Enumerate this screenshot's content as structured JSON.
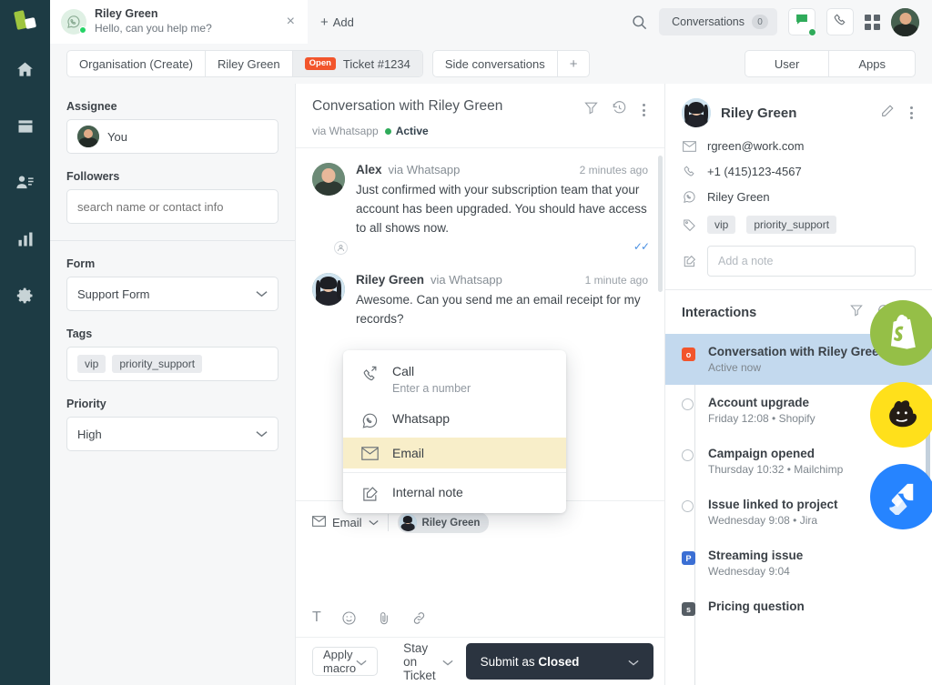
{
  "rail": {
    "logo_name": "app-logo",
    "items": [
      {
        "name": "home-icon",
        "label": "Home"
      },
      {
        "name": "inbox-icon",
        "label": "Inbox"
      },
      {
        "name": "contacts-icon",
        "label": "Contacts"
      },
      {
        "name": "reports-icon",
        "label": "Reports"
      },
      {
        "name": "settings-gear-icon",
        "label": "Settings"
      }
    ]
  },
  "topbar": {
    "conversation_pill": {
      "name": "Riley Green",
      "preview": "Hello, can you help me?",
      "channel_icon": "whatsapp-icon",
      "close_label": "×"
    },
    "add_label": "Add",
    "search_icon": "search-icon",
    "conversations_label": "Conversations",
    "conversations_count": "0",
    "chat_icon": "chat-bubble-icon",
    "phone_icon": "phone-icon",
    "apps_grid_icon": "grid-icon",
    "avatar_name": "user-avatar"
  },
  "tabs": {
    "left": [
      {
        "label": "Organisation (Create)",
        "badge": "",
        "active": false
      },
      {
        "label": "Riley Green",
        "badge": "",
        "active": false
      },
      {
        "label": "Ticket #1234",
        "badge": "Open",
        "active": true
      }
    ],
    "side_conversations_label": "Side conversations",
    "side_plus": "+",
    "right": [
      {
        "label": "User"
      },
      {
        "label": "Apps"
      }
    ]
  },
  "properties": {
    "assignee_label": "Assignee",
    "assignee_value": "You",
    "followers_label": "Followers",
    "followers_placeholder": "search name or contact info",
    "form_label": "Form",
    "form_value": "Support Form",
    "tags_label": "Tags",
    "tags": [
      "vip",
      "priority_support"
    ],
    "priority_label": "Priority",
    "priority_value": "High"
  },
  "conversation": {
    "title": "Conversation with Riley Green",
    "via": "via Whatsapp",
    "status": "Active",
    "filter_icon": "filter-icon",
    "history_icon": "history-icon",
    "more_icon": "more-vertical-icon",
    "messages": [
      {
        "author": "Alex",
        "via": "via Whatsapp",
        "time": "2 minutes ago",
        "text": "Just confirmed with your subscription team that your account has been upgraded. You should have access to all shows now.",
        "read_receipt": "✓✓",
        "is_agent": true
      },
      {
        "author": "Riley Green",
        "via": "via Whatsapp",
        "time": "1 minute ago",
        "text": "Awesome. Can you send me an email receipt for my records?",
        "read_receipt": "",
        "is_agent": false
      }
    ]
  },
  "channel_menu": {
    "items": [
      {
        "label": "Call",
        "sub": "Enter a number",
        "icon": "phone-forward-icon",
        "highlighted": false
      },
      {
        "label": "Whatsapp",
        "sub": "",
        "icon": "whatsapp-icon",
        "highlighted": false
      },
      {
        "label": "Email",
        "sub": "",
        "icon": "envelope-icon",
        "highlighted": true
      },
      {
        "label": "Internal note",
        "sub": "",
        "icon": "note-edit-icon",
        "highlighted": false
      }
    ]
  },
  "composer": {
    "channel_label": "Email",
    "channel_icon": "envelope-icon",
    "recipient": "Riley Green",
    "tools": [
      {
        "name": "text-format-icon",
        "glyph": "T"
      },
      {
        "name": "emoji-icon",
        "glyph": ""
      },
      {
        "name": "attachment-icon",
        "glyph": ""
      },
      {
        "name": "link-icon",
        "glyph": ""
      }
    ]
  },
  "footer": {
    "macro_label": "Apply macro",
    "stay_label": "Stay on Ticket",
    "submit_prefix": "Submit as ",
    "submit_state": "Closed"
  },
  "contact": {
    "name": "Riley Green",
    "edit_icon": "pencil-icon",
    "more_icon": "more-vertical-icon",
    "email": "rgreen@work.com",
    "phone": "+1 (415)123-4567",
    "whatsapp": "Riley Green",
    "tags": [
      "vip",
      "priority_support"
    ],
    "note_placeholder": "Add a note"
  },
  "interactions": {
    "title": "Interactions",
    "filter_icon": "filter-icon",
    "refresh_icon": "refresh-icon",
    "collapse_icon": "chevron-down-icon",
    "items": [
      {
        "title": "Conversation with Riley Green",
        "sub": "Active now",
        "marker": "square",
        "marker_label": "o",
        "marker_color": "#f2552c",
        "selected": true
      },
      {
        "title": "Account upgrade",
        "sub": "Friday 12:08 • Shopify",
        "marker": "ring",
        "marker_label": "",
        "marker_color": "",
        "selected": false
      },
      {
        "title": "Campaign opened",
        "sub": "Thursday 10:32 • Mailchimp",
        "marker": "ring",
        "marker_label": "",
        "marker_color": "",
        "selected": false
      },
      {
        "title": "Issue linked to project",
        "sub": "Wednesday 9:08 • Jira",
        "marker": "ring",
        "marker_label": "",
        "marker_color": "",
        "selected": false
      },
      {
        "title": "Streaming issue",
        "sub": "Wednesday 9:04",
        "marker": "square",
        "marker_label": "P",
        "marker_color": "#3b6fd4",
        "selected": false
      },
      {
        "title": "Pricing question",
        "sub": "",
        "marker": "square",
        "marker_label": "s",
        "marker_color": "#555d64",
        "selected": false
      }
    ]
  },
  "brands": [
    {
      "name": "shopify-logo",
      "color": "#95bf47"
    },
    {
      "name": "mailchimp-logo",
      "color": "#ffe01b"
    },
    {
      "name": "jira-logo",
      "color": "#2684ff"
    }
  ],
  "colors": {
    "rail_bg": "#1d3b44",
    "accent_green": "#2fab5a",
    "open_badge": "#f2552c",
    "submit_bg": "#2b3440",
    "selection_blue": "#c3d9ee",
    "menu_highlight": "#f8eec9"
  }
}
